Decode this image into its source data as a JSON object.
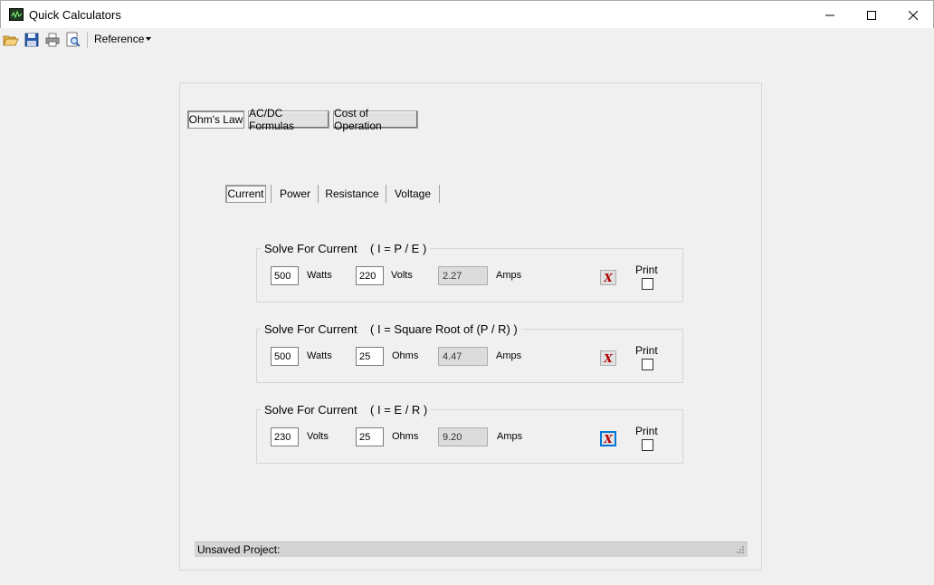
{
  "window": {
    "title": "Quick Calculators"
  },
  "toolbar": {
    "icons": [
      "open-folder-icon",
      "save-icon",
      "print-icon",
      "print-preview-icon"
    ],
    "reference_label": "Reference"
  },
  "tabs": [
    {
      "label": "Ohm's Law",
      "active": true
    },
    {
      "label": "AC/DC Formulas",
      "active": false
    },
    {
      "label": "Cost of Operation",
      "active": false
    }
  ],
  "subtabs": [
    {
      "label": "Current",
      "active": true
    },
    {
      "label": "Power",
      "active": false
    },
    {
      "label": "Resistance",
      "active": false
    },
    {
      "label": "Voltage",
      "active": false
    }
  ],
  "calculators": [
    {
      "title": "Solve For Current",
      "formula": "( I = P / E )",
      "input1": {
        "value": "500",
        "unit": "Watts"
      },
      "input2": {
        "value": "220",
        "unit": "Volts"
      },
      "result": {
        "value": "2.27",
        "unit": "Amps"
      },
      "clear_label": "X",
      "print_label": "Print",
      "print_checked": false
    },
    {
      "title": "Solve For Current",
      "formula": "( I = Square Root of (P / R) )",
      "input1": {
        "value": "500",
        "unit": "Watts"
      },
      "input2": {
        "value": "25",
        "unit": "Ohms"
      },
      "result": {
        "value": "4.47",
        "unit": "Amps"
      },
      "clear_label": "X",
      "print_label": "Print",
      "print_checked": false
    },
    {
      "title": "Solve For Current",
      "formula": "( I = E / R )",
      "input1": {
        "value": "230",
        "unit": "Volts"
      },
      "input2": {
        "value": "25",
        "unit": "Ohms"
      },
      "result": {
        "value": "9.20",
        "unit": "Amps"
      },
      "clear_label": "X",
      "print_label": "Print",
      "print_checked": false
    }
  ],
  "status": {
    "text": "Unsaved Project:"
  },
  "colors": {
    "window_bg": "#f0f0f0",
    "clear_button_x": "#b00000",
    "focus": "#0078d7"
  }
}
